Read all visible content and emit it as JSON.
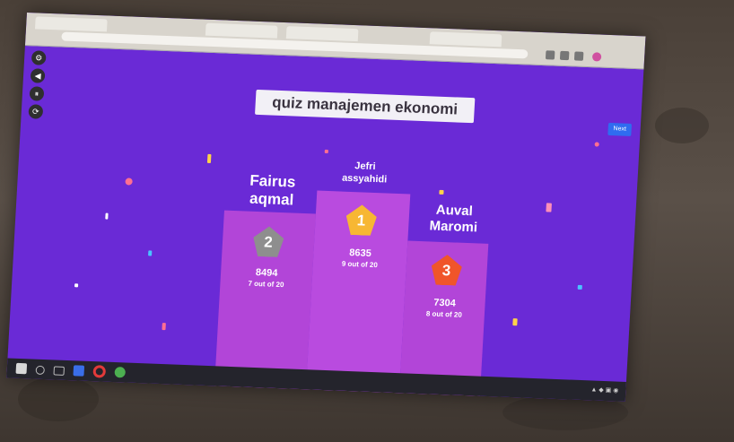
{
  "quiz": {
    "title": "quiz manajemen ekonomi",
    "next_label": "Next"
  },
  "sidebar": {
    "buttons": [
      "⚙",
      "◀",
      "⏸",
      "⟳"
    ]
  },
  "podium": {
    "first": {
      "rank": "1",
      "name_line1": "Jefri",
      "name_line2": "assyahidi",
      "score": "8635",
      "outof": "9 out of 20"
    },
    "second": {
      "rank": "2",
      "name_line1": "Fairus",
      "name_line2": "aqmal",
      "score": "8494",
      "outof": "7 out of 20"
    },
    "third": {
      "rank": "3",
      "name_line1": "Auval",
      "name_line2": "Maromi",
      "score": "7304",
      "outof": "8 out of 20"
    }
  },
  "colors": {
    "background": "#6a2ad6",
    "podium": "#b848d8",
    "badge_first": "#f7b733",
    "badge_second": "#8e8e8e",
    "badge_third": "#f0552a"
  },
  "taskbar": {
    "icons": [
      "windows-icon",
      "search-icon",
      "task-view-icon",
      "file-explorer-icon",
      "opera-icon",
      "chrome-icon"
    ]
  }
}
